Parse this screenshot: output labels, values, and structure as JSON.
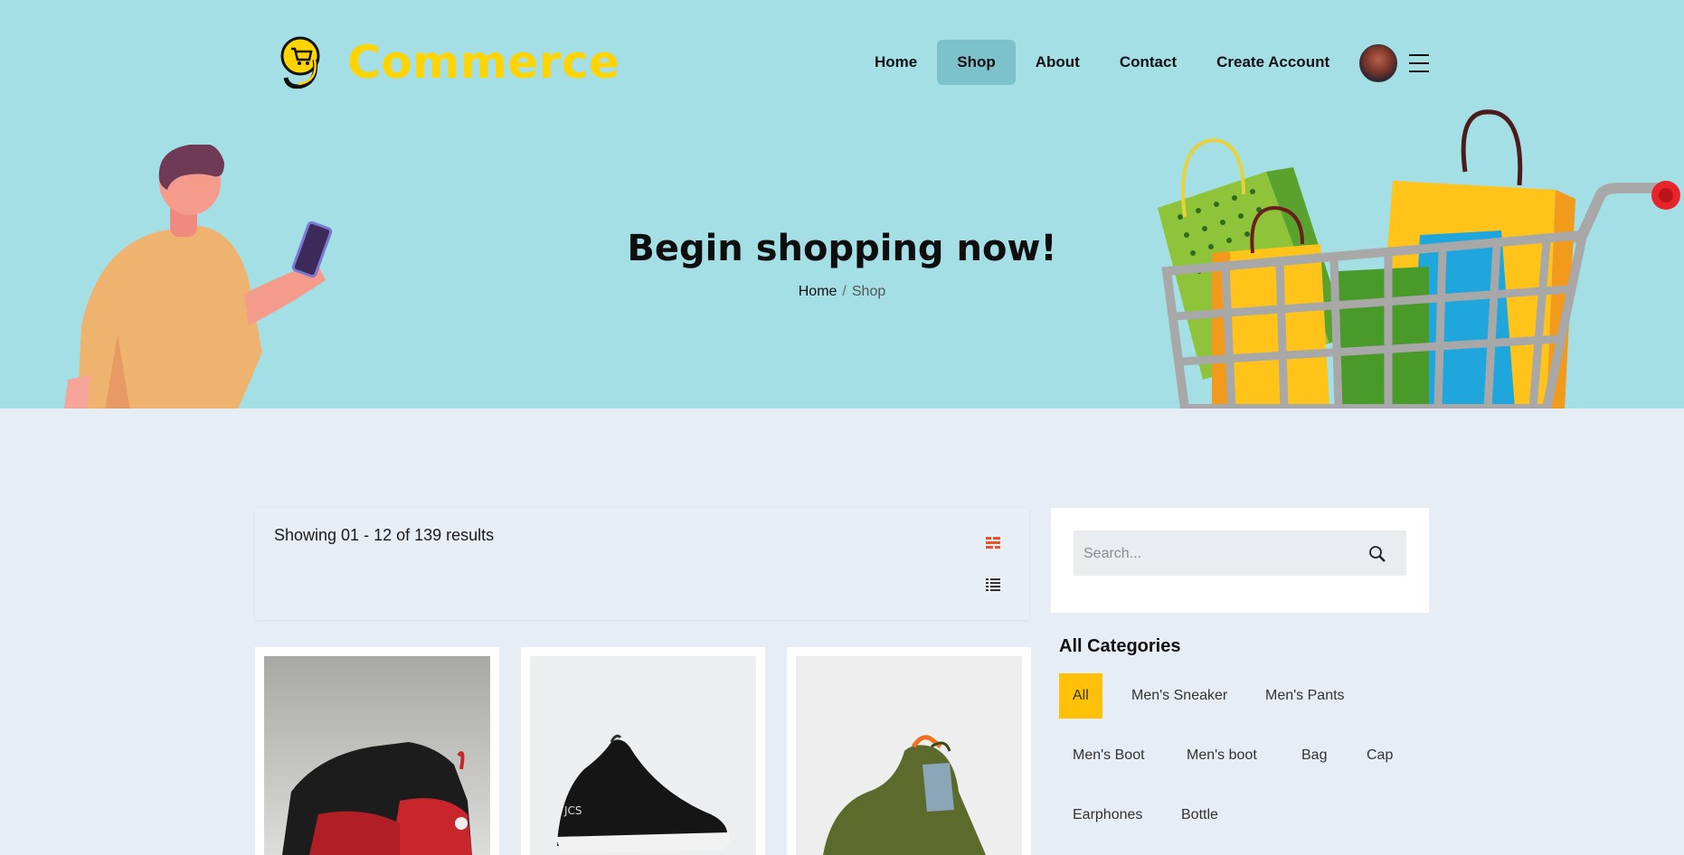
{
  "brand": {
    "name": "Commerce",
    "color": "#ffd400"
  },
  "nav": {
    "items": [
      {
        "label": "Home",
        "active": false
      },
      {
        "label": "Shop",
        "active": true
      },
      {
        "label": "About",
        "active": false
      },
      {
        "label": "Contact",
        "active": false
      },
      {
        "label": "Create Account",
        "active": false
      }
    ],
    "avatar_icon": "user-avatar",
    "menu_icon": "hamburger-icon"
  },
  "hero": {
    "title": "Begin shopping now!",
    "breadcrumb": {
      "home": "Home",
      "separator": "/",
      "current": "Shop"
    }
  },
  "toolbar": {
    "results_text": "Showing 01 - 12 of 139 results",
    "view_grid_icon": "grid-view-icon",
    "view_list_icon": "list-view-icon",
    "active_view_color": "#e8532b"
  },
  "products": [
    {
      "image_alt": "Black and red high-top sneaker"
    },
    {
      "image_alt": "Black knit sneaker"
    },
    {
      "image_alt": "Olive high-top sneaker"
    }
  ],
  "search": {
    "placeholder": "Search..."
  },
  "categories": {
    "title": "All Categories",
    "items": [
      {
        "label": "All",
        "active": true
      },
      {
        "label": "Men's Sneaker",
        "active": false
      },
      {
        "label": "Men's Pants",
        "active": false
      },
      {
        "label": "Men's Boot",
        "active": false
      },
      {
        "label": "Men's boot",
        "active": false
      },
      {
        "label": "Bag",
        "active": false
      },
      {
        "label": "Cap",
        "active": false
      },
      {
        "label": "Earphones",
        "active": false
      },
      {
        "label": "Bottle",
        "active": false
      }
    ],
    "active_color": "#ffc107"
  }
}
